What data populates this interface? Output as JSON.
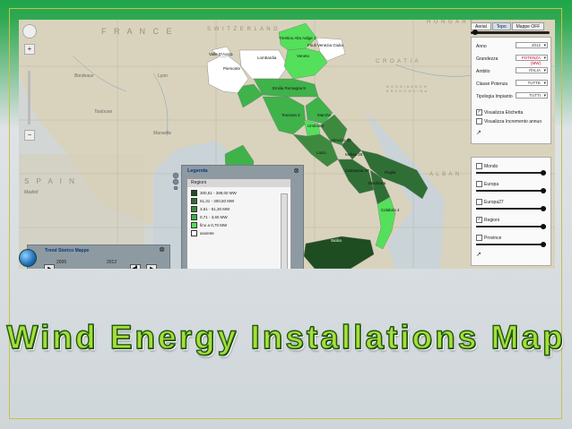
{
  "slide": {
    "title": "Wind Energy Installations Map",
    "accent_green": "#1fa64a",
    "frame_color": "#c7c24a"
  },
  "map": {
    "country_labels": [
      "F R A N C E",
      "S W I T Z E R L A N D",
      "H U N G A R Y",
      "C R O A T I A",
      "B O S N I A  A N D  H E R Z E G O V I N A",
      "S P A I N",
      "A L B A N"
    ],
    "cities": [
      "Bordeaux",
      "Toulouse",
      "Madrid",
      "Marseille",
      "Lyon"
    ],
    "regions": [
      {
        "name": "Trentino Alto Adige",
        "value": "1"
      },
      {
        "name": "Friuli Venezia Giulia",
        "value": ""
      },
      {
        "name": "Valle D'Aosta",
        "value": ""
      },
      {
        "name": "Lombardia",
        "value": ""
      },
      {
        "name": "Veneto",
        "value": ""
      },
      {
        "name": "Piemonte",
        "value": ""
      },
      {
        "name": "Emilia Romagna",
        "value": "5"
      },
      {
        "name": "Toscana",
        "value": "3"
      },
      {
        "name": "Marche",
        "value": ""
      },
      {
        "name": "Umbria",
        "value": "2"
      },
      {
        "name": "Abruzzo",
        "value": "22"
      },
      {
        "name": "Lazio",
        "value": ""
      },
      {
        "name": "Molise",
        "value": "25"
      },
      {
        "name": "Campania",
        "value": "47"
      },
      {
        "name": "Puglia",
        "value": ""
      },
      {
        "name": "Basilicata",
        "value": ""
      },
      {
        "name": "Calabria",
        "value": "4"
      },
      {
        "name": "Sicilia",
        "value": ""
      }
    ],
    "region_colors": {
      "very_dark": "#1f4d22",
      "dark": "#2f6f35",
      "medium": "#3d8a3f",
      "light": "#3fb24a",
      "lightest": "#54e05a",
      "absent": "#ffffff"
    }
  },
  "nav": {
    "ring_icon": "arrow-icon",
    "zoom_in": "+",
    "zoom_out": "−"
  },
  "panel": {
    "tabs": [
      "Aerial",
      "Topo",
      "Mappe OFF"
    ],
    "active_tab": "Topo",
    "filters": [
      {
        "label": "Anno",
        "value": "2012"
      },
      {
        "label": "Grandezza",
        "value": "POTENZA (MW)"
      },
      {
        "label": "Ambito",
        "value": "ITALIA"
      },
      {
        "label": "Classe Potenza",
        "value": "TUTTE"
      },
      {
        "label": "Tipologia Impianto",
        "value": "TUTTI"
      }
    ],
    "checkboxes": [
      {
        "label": "Visualizza Etichetta",
        "checked": true
      },
      {
        "label": "Visualizza Incremento annuo",
        "checked": false
      }
    ],
    "layers": [
      {
        "label": "Mondo",
        "checked": false
      },
      {
        "label": "Europa",
        "checked": false
      },
      {
        "label": "Europa27",
        "checked": false
      },
      {
        "label": "Regioni",
        "checked": true
      },
      {
        "label": "Province",
        "checked": false
      }
    ]
  },
  "legend": {
    "title": "Legenda",
    "header": "Regioni",
    "items": [
      {
        "label": "300,51 - 399,00 MW",
        "color": "#1f4d22"
      },
      {
        "label": "51,31 - 300,50 MW",
        "color": "#2f6f35"
      },
      {
        "label": "3,61 - 51,30 MW",
        "color": "#3d8a3f"
      },
      {
        "label": "0,71 - 3,60 MW",
        "color": "#3fb24a"
      },
      {
        "label": "fino a 0,70 MW",
        "color": "#54e05a"
      },
      {
        "label": "assente",
        "color": "#ffffff"
      }
    ]
  },
  "trend": {
    "title": "Trend Storico Mappe",
    "year_start": "2005",
    "year_end": "2012"
  }
}
